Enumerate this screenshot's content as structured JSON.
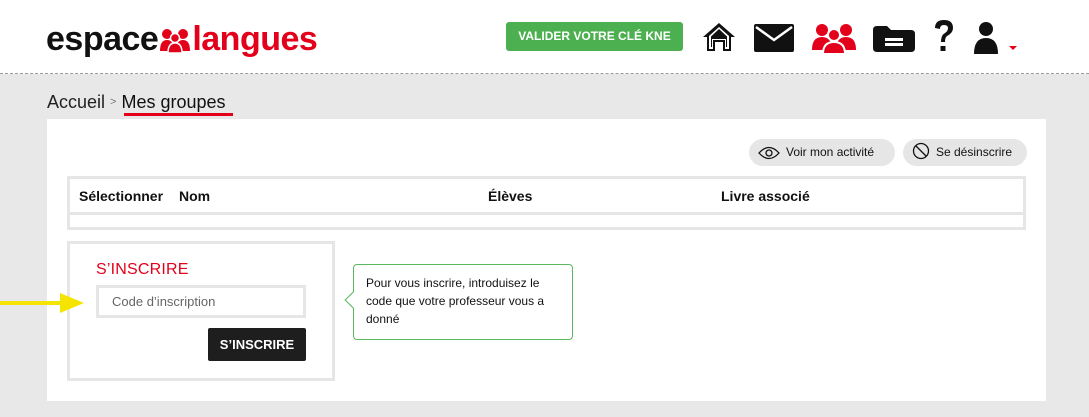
{
  "header": {
    "logo_part1": "espace",
    "logo_part2": "langues",
    "kne_button": "VALIDER VOTRE CLÉ KNE",
    "icons": [
      "home-icon",
      "mail-icon",
      "groups-icon",
      "folder-icon",
      "help-icon",
      "user-icon"
    ],
    "accent_color": "#e2001a",
    "kne_color": "#4caf50"
  },
  "breadcrumb": {
    "home": "Accueil",
    "separator": ">",
    "current": "Mes groupes"
  },
  "actions": {
    "view_activity": "Voir mon activité",
    "unsubscribe": "Se désinscrire"
  },
  "table": {
    "columns": [
      "Sélectionner",
      "Nom",
      "Élèves",
      "Livre associé"
    ],
    "rows": []
  },
  "signup": {
    "title": "S’INSCRIRE",
    "code_placeholder": "Code d’inscription",
    "code_value": "",
    "button": "S’INSCRIRE"
  },
  "tooltip": {
    "text": "Pour vous inscrire, introduisez le code que votre professeur vous a donné"
  }
}
